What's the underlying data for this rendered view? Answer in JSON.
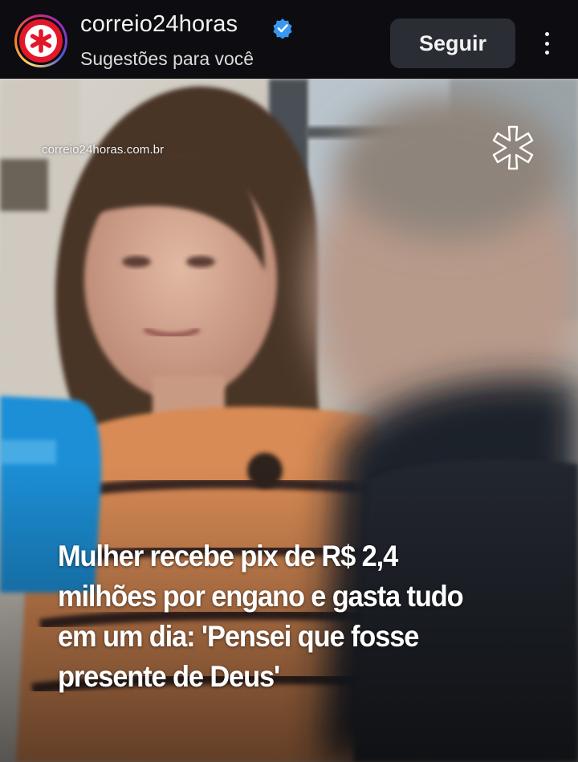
{
  "header": {
    "account_name": "correio24horas",
    "subtitle": "Sugestões para você",
    "follow_label": "Seguir",
    "verified": true
  },
  "post": {
    "watermark": "correio24horas.com.br",
    "headline_lines": [
      "Mulher recebe pix de R$ 2,4",
      "milhões por engano e gasta tudo",
      "em um dia: 'Pensei que fosse",
      "presente de Deus'"
    ]
  },
  "colors": {
    "header_bg": "#0c0c11",
    "follow_button_bg": "#2a2d33",
    "brand_red": "#e2172a",
    "verified_blue": "#3897f0"
  },
  "icons": {
    "verified": "verified-badge-icon",
    "more": "more-options-icon",
    "brand": "asterisk-logo-icon"
  }
}
